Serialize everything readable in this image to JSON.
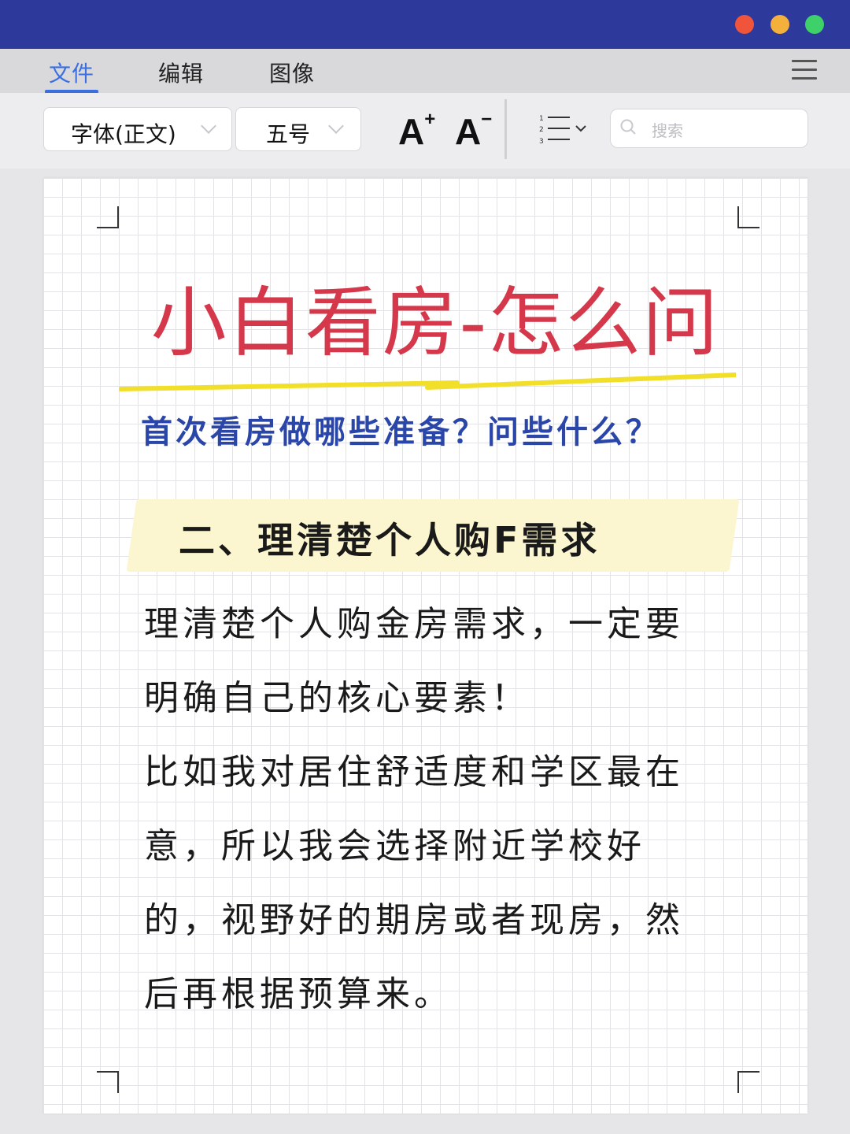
{
  "window": {
    "controls": [
      "close",
      "minimize",
      "maximize"
    ],
    "colors": {
      "titlebar": "#2d3a9b",
      "close": "#f0553b",
      "minimize": "#f3b03a",
      "maximize": "#3ed16a"
    }
  },
  "menu": {
    "items": [
      {
        "label": "文件",
        "active": true
      },
      {
        "label": "编辑",
        "active": false
      },
      {
        "label": "图像",
        "active": false
      }
    ],
    "accent": "#3b6fe0"
  },
  "toolbar": {
    "font_family": "字体(正文)",
    "font_size": "五号",
    "increase_font_label": "A",
    "increase_font_sup": "+",
    "decrease_font_label": "A",
    "decrease_font_sup": "−",
    "list_icon": "numbered-list-icon",
    "search_placeholder": "搜索"
  },
  "document": {
    "title": "小白看房-怎么问",
    "title_color": "#d4384a",
    "subtitle": "首次看房做哪些准备？问些什么？",
    "subtitle_color": "#2a46a8",
    "section_heading": "二、理清楚个人购F需求",
    "paragraph_lines": [
      "理清楚个人购金房需求，一定要",
      "明确自己的核心要素！",
      "比如我对居住舒适度和学区最在",
      "意，所以我会选择附近学校好",
      "的，视野好的期房或者现房，然",
      "后再根据预算来。"
    ]
  }
}
